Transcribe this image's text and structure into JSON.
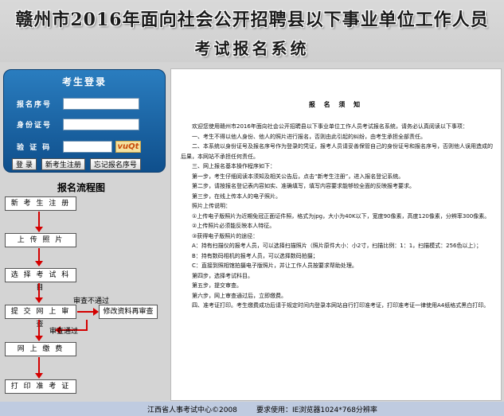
{
  "header": {
    "title_line1": "赣州市2016年面向社会公开招聘县以下事业单位工作人员",
    "title_line2": "考试报名系统"
  },
  "login": {
    "title": "考生登录",
    "fields": {
      "reg_no_label": "报名序号",
      "id_label": "身份证号",
      "captcha_label": "验 证 码",
      "captcha_value": "vuQt"
    },
    "buttons": {
      "login": "登 录",
      "register": "新考生注册",
      "forgot": "忘记报名序号"
    }
  },
  "flow": {
    "title": "报名流程图",
    "steps": [
      "新 考 生 注 册",
      "上 传 照 片",
      "选 择 考 试 科 目",
      "提 交 网 上 审 查",
      "网 上 缴 费",
      "打 印 准 考 证"
    ],
    "side_step": "修改资料再审查",
    "label_fail": "审查不通过",
    "label_pass": "审查通过"
  },
  "notice": {
    "title": "报 名 须 知",
    "paragraphs": [
      "　　欢迎您使用赣州市2016年面向社会公开招聘县以下事业单位工作人员考试报名系统，请务必认真阅读以下事项：",
      "　　一、考生不得以他人身份、他人的照片进行报名，否则由此引起的纠纷，由考生承担全部责任。",
      "　　二、本系统以身份证号及报名序号作为登录的凭证，报考人员请妥善保管自己的身份证号和报名序号，否则他人误用造成的后果，本网站不承担任何责任。",
      "　　三、网上报名基本操作程序如下：",
      "　　第一步，考生仔细阅读本须知及相关公告后，点击“新考生注册”，进入报名登记系统。",
      "　　第二步，请按报名登记表内容如实、准确填写，填写内容要求能够较全面的反映报考要求。",
      "　　第三步，在线上传本人的电子照片。",
      "　　照片上传说明：",
      "　　①上传电子版照片为近期免冠正面证件照，格式为jpg，大小为40K以下，宽度90像素，高度120像素，分辨率300像素。",
      "　　②上传照片必须能反映本人特征。",
      "　　③获得电子版照片的途径：",
      "　　A：持有扫描仪的报考人员，可以选择扫描照片（照片原件大小：小2寸，扫描比例：1：1，扫描模式：256色以上）；",
      "　　B：持有数码相机的报考人员，可以选择数码拍摄；",
      "　　C：直接到照相馆拍摄电子版照片，并让工作人员按要求帮助处理。",
      "　　第四步，选择考试科目。",
      "　　第五步，提交审查。",
      "　　第六步，网上审查通过后，立即缴费。",
      "　　四、准考证打印。考生缴费成功后请于规定时间内登录本网站自行打印准考证，打印准考证一律使用A4纸格式黑白打印。"
    ]
  },
  "footer": {
    "copyright": "江西省人事考试中心©2008",
    "requirement": "要求使用：IE浏览器1024*768分辨率"
  }
}
